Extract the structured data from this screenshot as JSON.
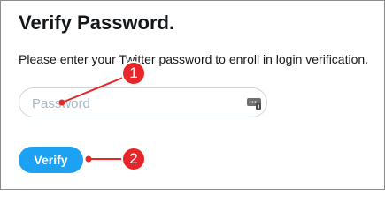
{
  "header": {
    "title": "Verify Password."
  },
  "description": "Please enter your Twitter password to enroll in login verification.",
  "password_field": {
    "placeholder": "Password",
    "value": "",
    "icon": "password-manager-key-icon"
  },
  "verify_button": {
    "label": "Verify"
  },
  "annotations": {
    "color": "#e8262a",
    "markers": [
      {
        "label": "1",
        "target": "password-field"
      },
      {
        "label": "2",
        "target": "verify-button"
      }
    ]
  },
  "colors": {
    "accent": "#1da1f2",
    "text": "#14171a",
    "border": "#ccd6dd",
    "placeholder": "#aab8c2"
  }
}
